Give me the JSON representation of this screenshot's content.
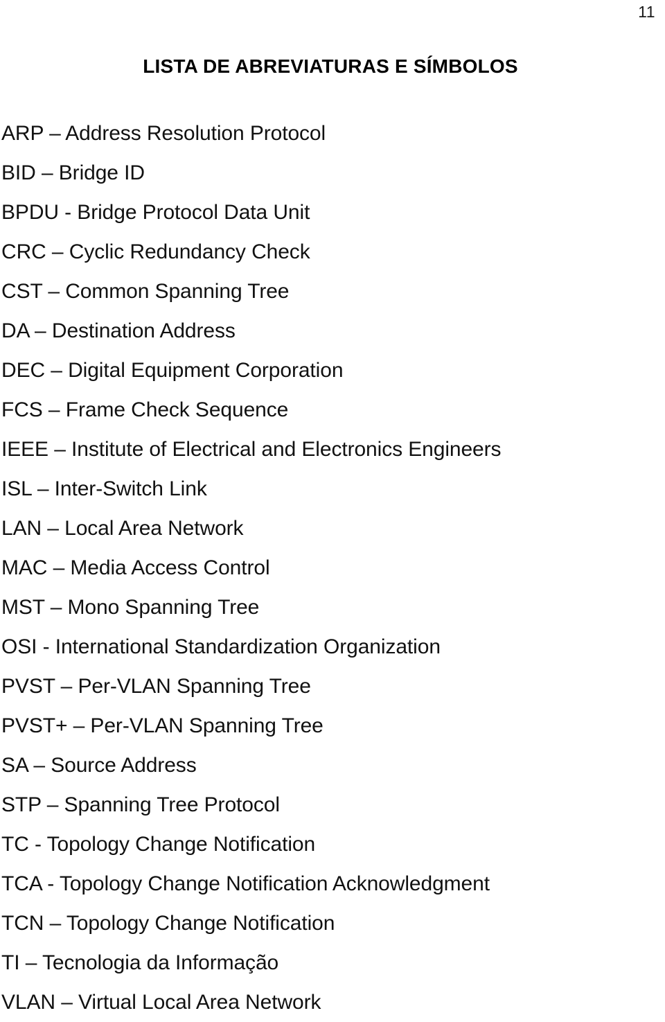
{
  "page": {
    "number": "11",
    "title": "LISTA DE ABREVIATURAS E SÍMBOLOS",
    "background_color": "#ffffff",
    "text_color": "#000000"
  },
  "abbreviations": [
    {
      "text": "ARP – Address Resolution Protocol"
    },
    {
      "text": "BID – Bridge ID"
    },
    {
      "text": "BPDU - Bridge Protocol Data Unit"
    },
    {
      "text": "CRC – Cyclic Redundancy Check"
    },
    {
      "text": "CST – Common Spanning Tree"
    },
    {
      "text": "DA – Destination Address"
    },
    {
      "text": "DEC – Digital Equipment Corporation"
    },
    {
      "text": "FCS – Frame Check Sequence"
    },
    {
      "text": "IEEE – Institute of Electrical and Electronics Engineers"
    },
    {
      "text": "ISL – Inter-Switch Link"
    },
    {
      "text": "LAN – Local Area Network"
    },
    {
      "text": "MAC – Media Access Control"
    },
    {
      "text": "MST – Mono Spanning Tree"
    },
    {
      "text": "OSI - International Standardization Organization"
    },
    {
      "text": "PVST – Per-VLAN Spanning Tree"
    },
    {
      "text": "PVST+ – Per-VLAN Spanning Tree"
    },
    {
      "text": "SA – Source Address"
    },
    {
      "text": "STP – Spanning Tree Protocol"
    },
    {
      "text": "TC - Topology Change Notification"
    },
    {
      "text": "TCA - Topology Change Notification Acknowledgment"
    },
    {
      "text": "TCN – Topology Change Notification"
    },
    {
      "text": "TI – Tecnologia da Informação"
    },
    {
      "text": "VLAN – Virtual Local Area Network"
    }
  ]
}
